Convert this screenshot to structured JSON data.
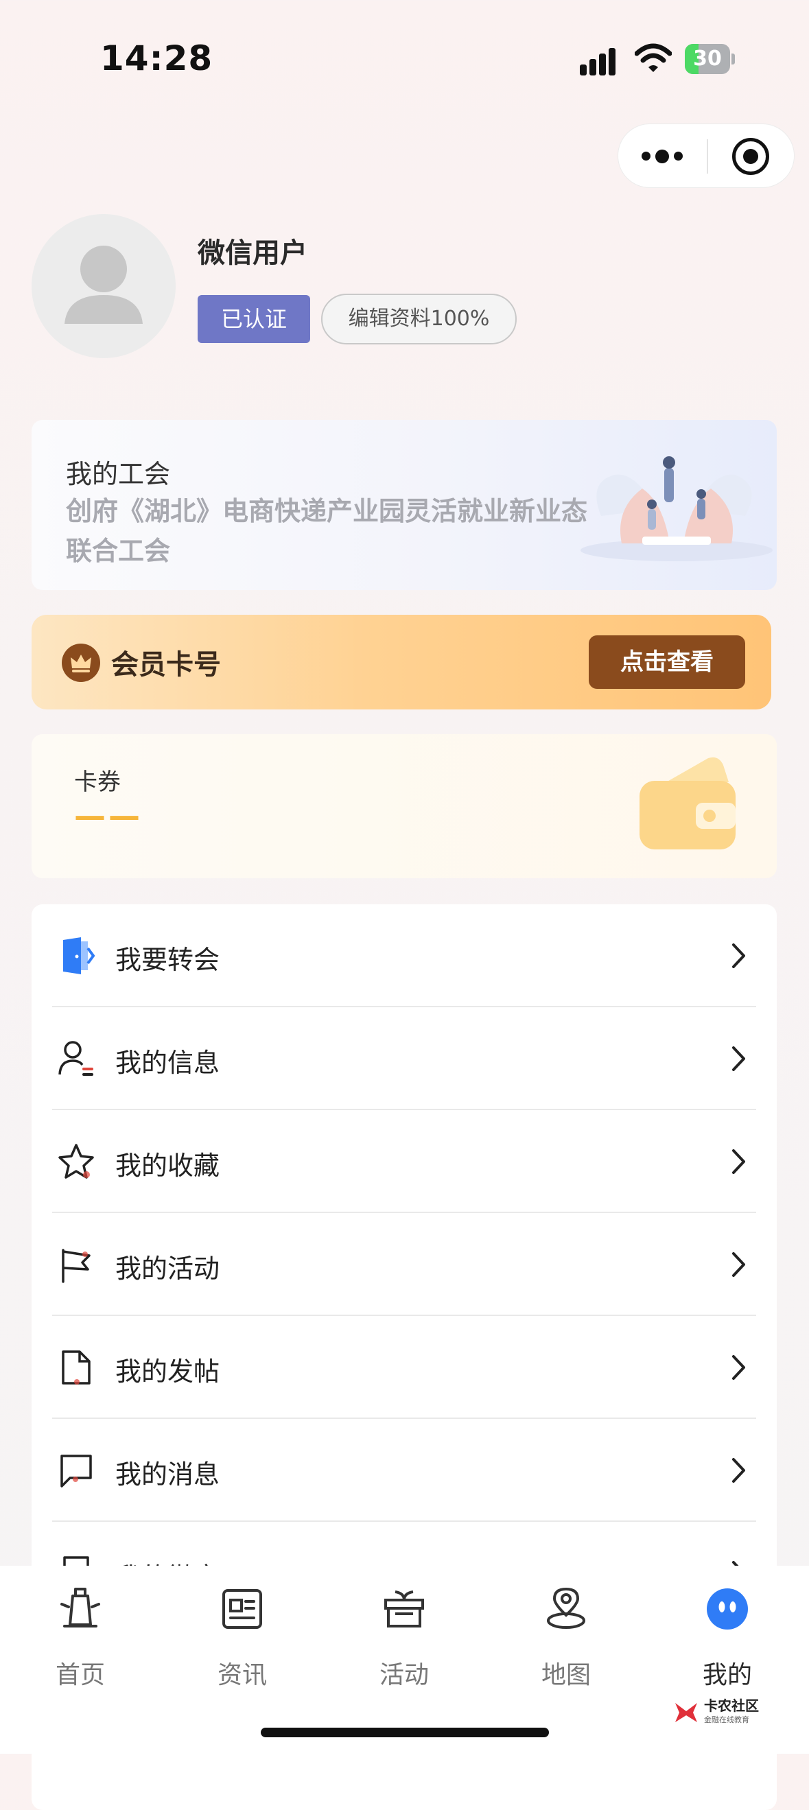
{
  "status_bar": {
    "time": "14:28",
    "battery": "30",
    "battery_level": 0.3
  },
  "profile": {
    "username": "微信用户",
    "verified_label": "已认证",
    "edit_label": "编辑资料100%"
  },
  "union": {
    "title": "我的工会",
    "name": "创府《湖北》电商快递产业园灵活就业新业态联合工会"
  },
  "member": {
    "title": "会员卡号",
    "button_label": "点击查看"
  },
  "coupon": {
    "title": "卡券",
    "value": "——"
  },
  "menu": [
    {
      "label": "我要转会",
      "icon": "door-icon"
    },
    {
      "label": "我的信息",
      "icon": "user-info-icon"
    },
    {
      "label": "我的收藏",
      "icon": "star-icon"
    },
    {
      "label": "我的活动",
      "icon": "flag-icon"
    },
    {
      "label": "我的发帖",
      "icon": "document-icon"
    },
    {
      "label": "我的消息",
      "icon": "message-icon"
    },
    {
      "label": "我的徽章",
      "icon": "badge-icon"
    }
  ],
  "tabs": [
    {
      "label": "首页",
      "icon": "tower-icon"
    },
    {
      "label": "资讯",
      "icon": "news-icon"
    },
    {
      "label": "活动",
      "icon": "gift-icon"
    },
    {
      "label": "地图",
      "icon": "map-pin-icon"
    },
    {
      "label": "我的",
      "icon": "profile-face-icon",
      "active": true
    }
  ],
  "watermark": {
    "title": "卡农社区",
    "subtitle": "金融在线教育"
  },
  "colors": {
    "accent": "#6f77c6",
    "member_button": "#8a4b1d",
    "active_tab": "#2f7cf6",
    "coupon_value": "#f6b53a"
  }
}
